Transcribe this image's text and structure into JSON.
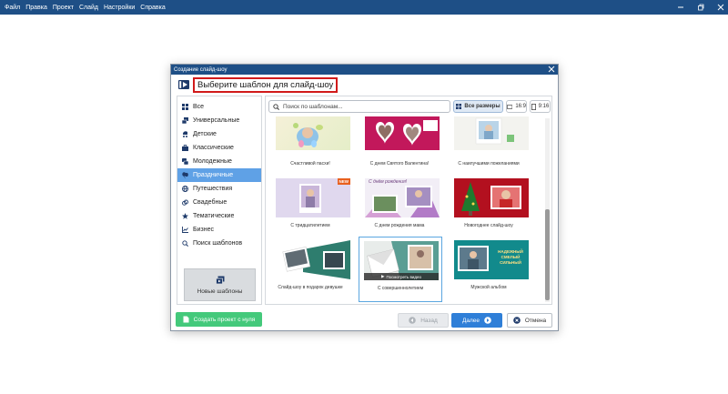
{
  "menu": [
    "Файл",
    "Правка",
    "Проект",
    "Слайд",
    "Настройки",
    "Справка"
  ],
  "dialog": {
    "title": "Создание слайд-шоу",
    "heading": "Выберите шаблон для слайд-шоу"
  },
  "sidebar": {
    "categories": [
      {
        "label": "Все",
        "icon": "grid-icon"
      },
      {
        "label": "Универсальные",
        "icon": "layers-icon"
      },
      {
        "label": "Детские",
        "icon": "stroller-icon"
      },
      {
        "label": "Классические",
        "icon": "briefcase-icon"
      },
      {
        "label": "Молодежные",
        "icon": "chat-icon"
      },
      {
        "label": "Праздничные",
        "icon": "balloons-icon",
        "active": true
      },
      {
        "label": "Путешествия",
        "icon": "globe-icon"
      },
      {
        "label": "Свадебные",
        "icon": "rings-icon"
      },
      {
        "label": "Тематические",
        "icon": "star-icon"
      },
      {
        "label": "Бизнес",
        "icon": "chart-icon"
      },
      {
        "label": "Поиск шаблонов",
        "icon": "search-icon"
      }
    ],
    "new_templates_label": "Новые шаблоны"
  },
  "search": {
    "placeholder": "Поиск по шаблонам..."
  },
  "size_filters": [
    "Все размеры",
    "16:9",
    "9:16"
  ],
  "templates": [
    {
      "caption": "Счастливой пасхи!",
      "badge": ""
    },
    {
      "caption": "С днем Святого Валентина!",
      "badge": ""
    },
    {
      "caption": "С наилучшими пожеланиями",
      "badge": ""
    },
    {
      "caption": "С тридцатилетием",
      "badge": "NEW"
    },
    {
      "caption": "С днем рождения мама",
      "badge": "",
      "overlay": "С днём рождения!"
    },
    {
      "caption": "Новогоднее слайд-шоу",
      "badge": ""
    },
    {
      "caption": "Слайд-шоу в подарок девушке",
      "badge": ""
    },
    {
      "caption": "С совершеннолетием",
      "badge": "",
      "selected": true,
      "play_label": "Посмотреть видео"
    },
    {
      "caption": "Мужской альбом",
      "badge": "",
      "overlay": "НАДЕЖНЫЙ СМЕЛЫЙ СИЛЬНЫЙ"
    }
  ],
  "footer": {
    "create_label": "Создать проект с нуля",
    "back_label": "Назад",
    "next_label": "Далее",
    "cancel_label": "Отмена"
  },
  "colors": {
    "titlebar": "#1e4f86",
    "accent": "#2f7fd8",
    "active_category": "#5fa1e6",
    "create_button": "#44c97b",
    "heading_border": "#d11a1a"
  }
}
